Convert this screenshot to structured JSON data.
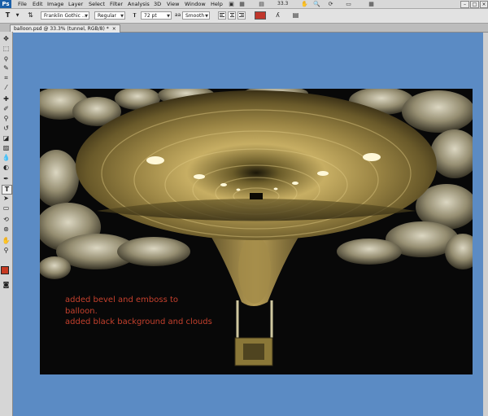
{
  "menubar": {
    "logo": "Ps",
    "items": [
      "File",
      "Edit",
      "Image",
      "Layer",
      "Select",
      "Filter",
      "Analysis",
      "3D",
      "View",
      "Window",
      "Help"
    ],
    "zoom": "33.3"
  },
  "options": {
    "tool_glyph": "T",
    "font_family": "Franklin Gothic ...",
    "font_style": "Regular",
    "font_size": "72 pt",
    "anti_alias": "Smooth",
    "text_color": "#c0362b"
  },
  "document_tab": {
    "title": "balloon.psd @ 33.3% (tunnel, RGB/8) *",
    "close": "×"
  },
  "toolbox": {
    "tools": [
      "search-tool",
      "marquee",
      "lasso",
      "quick-select",
      "crop",
      "eyedropper",
      "healing",
      "brush",
      "stamp",
      "history-brush",
      "eraser",
      "gradient",
      "blur",
      "dodge",
      "pen",
      "type",
      "path-select",
      "shape",
      "hand",
      "zoom"
    ]
  },
  "canvas": {
    "background": "#5b8bc4",
    "caption_lines": [
      "added bevel and emboss to",
      "balloon.",
      "added black background and clouds"
    ],
    "caption_color": "#c4402d"
  }
}
